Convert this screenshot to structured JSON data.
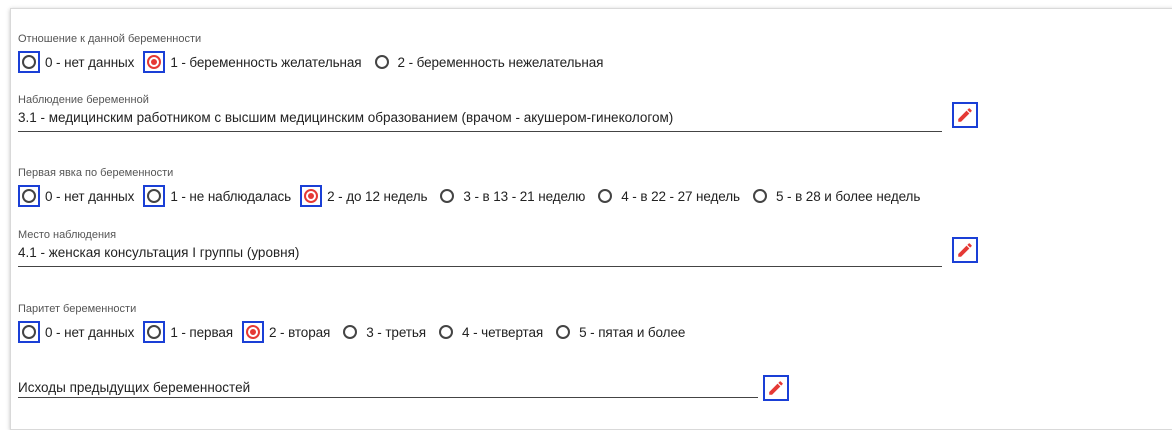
{
  "colors": {
    "selected": "#e53935",
    "highlight_border": "#1a3fd6",
    "icon": "#e53935"
  },
  "attitude": {
    "caption": "Отношение к данной беременности",
    "options": [
      "0 - нет данных",
      "1 - беременность желательная",
      "2 - беременность нежелательная"
    ],
    "selected": "1 - беременность желательная"
  },
  "observation": {
    "caption": "Наблюдение беременной",
    "value": "3.1 - медицинским работником с высшим медицинским образованием (врачом - акушером-гинекологом)",
    "edit_icon": "pencil-icon"
  },
  "first_visit": {
    "caption": "Первая явка по беременности",
    "options": [
      "0 - нет данных",
      "1 - не наблюдалась",
      "2 - до 12 недель",
      "3 - в 13 - 21 неделю",
      "4 - в 22 - 27 недель",
      "5 - в 28 и более недель"
    ],
    "selected": "2 - до 12 недель"
  },
  "place": {
    "caption": "Место наблюдения",
    "value": "4.1 - женская консультация I группы (уровня)",
    "edit_icon": "pencil-icon"
  },
  "parity": {
    "caption": "Паритет беременности",
    "options": [
      "0 - нет данных",
      "1 - первая",
      "2 - вторая",
      "3 - третья",
      "4 - четвертая",
      "5 - пятая и более"
    ],
    "selected": "2 - вторая"
  },
  "outcomes": {
    "placeholder": "Исходы предыдущих беременностей",
    "edit_icon": "pencil-icon"
  }
}
